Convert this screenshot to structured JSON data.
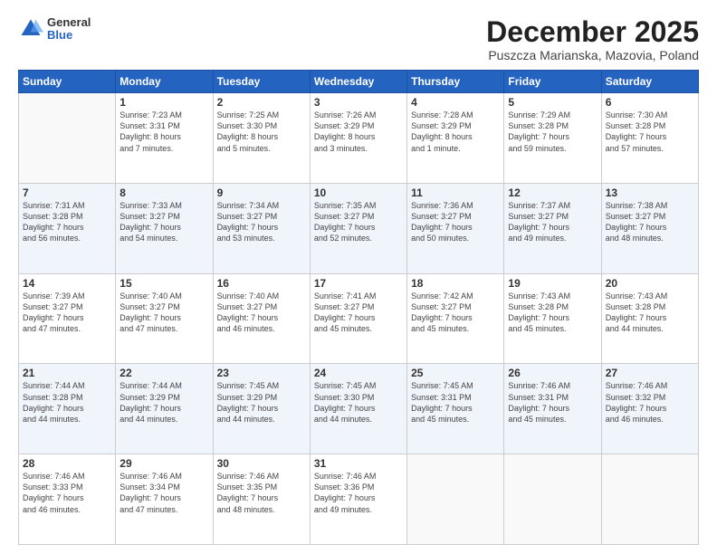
{
  "logo": {
    "general": "General",
    "blue": "Blue"
  },
  "header": {
    "month": "December 2025",
    "location": "Puszcza Marianska, Mazovia, Poland"
  },
  "weekdays": [
    "Sunday",
    "Monday",
    "Tuesday",
    "Wednesday",
    "Thursday",
    "Friday",
    "Saturday"
  ],
  "weeks": [
    [
      {
        "day": "",
        "info": ""
      },
      {
        "day": "1",
        "info": "Sunrise: 7:23 AM\nSunset: 3:31 PM\nDaylight: 8 hours\nand 7 minutes."
      },
      {
        "day": "2",
        "info": "Sunrise: 7:25 AM\nSunset: 3:30 PM\nDaylight: 8 hours\nand 5 minutes."
      },
      {
        "day": "3",
        "info": "Sunrise: 7:26 AM\nSunset: 3:29 PM\nDaylight: 8 hours\nand 3 minutes."
      },
      {
        "day": "4",
        "info": "Sunrise: 7:28 AM\nSunset: 3:29 PM\nDaylight: 8 hours\nand 1 minute."
      },
      {
        "day": "5",
        "info": "Sunrise: 7:29 AM\nSunset: 3:28 PM\nDaylight: 7 hours\nand 59 minutes."
      },
      {
        "day": "6",
        "info": "Sunrise: 7:30 AM\nSunset: 3:28 PM\nDaylight: 7 hours\nand 57 minutes."
      }
    ],
    [
      {
        "day": "7",
        "info": "Sunrise: 7:31 AM\nSunset: 3:28 PM\nDaylight: 7 hours\nand 56 minutes."
      },
      {
        "day": "8",
        "info": "Sunrise: 7:33 AM\nSunset: 3:27 PM\nDaylight: 7 hours\nand 54 minutes."
      },
      {
        "day": "9",
        "info": "Sunrise: 7:34 AM\nSunset: 3:27 PM\nDaylight: 7 hours\nand 53 minutes."
      },
      {
        "day": "10",
        "info": "Sunrise: 7:35 AM\nSunset: 3:27 PM\nDaylight: 7 hours\nand 52 minutes."
      },
      {
        "day": "11",
        "info": "Sunrise: 7:36 AM\nSunset: 3:27 PM\nDaylight: 7 hours\nand 50 minutes."
      },
      {
        "day": "12",
        "info": "Sunrise: 7:37 AM\nSunset: 3:27 PM\nDaylight: 7 hours\nand 49 minutes."
      },
      {
        "day": "13",
        "info": "Sunrise: 7:38 AM\nSunset: 3:27 PM\nDaylight: 7 hours\nand 48 minutes."
      }
    ],
    [
      {
        "day": "14",
        "info": "Sunrise: 7:39 AM\nSunset: 3:27 PM\nDaylight: 7 hours\nand 47 minutes."
      },
      {
        "day": "15",
        "info": "Sunrise: 7:40 AM\nSunset: 3:27 PM\nDaylight: 7 hours\nand 47 minutes."
      },
      {
        "day": "16",
        "info": "Sunrise: 7:40 AM\nSunset: 3:27 PM\nDaylight: 7 hours\nand 46 minutes."
      },
      {
        "day": "17",
        "info": "Sunrise: 7:41 AM\nSunset: 3:27 PM\nDaylight: 7 hours\nand 45 minutes."
      },
      {
        "day": "18",
        "info": "Sunrise: 7:42 AM\nSunset: 3:27 PM\nDaylight: 7 hours\nand 45 minutes."
      },
      {
        "day": "19",
        "info": "Sunrise: 7:43 AM\nSunset: 3:28 PM\nDaylight: 7 hours\nand 45 minutes."
      },
      {
        "day": "20",
        "info": "Sunrise: 7:43 AM\nSunset: 3:28 PM\nDaylight: 7 hours\nand 44 minutes."
      }
    ],
    [
      {
        "day": "21",
        "info": "Sunrise: 7:44 AM\nSunset: 3:28 PM\nDaylight: 7 hours\nand 44 minutes."
      },
      {
        "day": "22",
        "info": "Sunrise: 7:44 AM\nSunset: 3:29 PM\nDaylight: 7 hours\nand 44 minutes."
      },
      {
        "day": "23",
        "info": "Sunrise: 7:45 AM\nSunset: 3:29 PM\nDaylight: 7 hours\nand 44 minutes."
      },
      {
        "day": "24",
        "info": "Sunrise: 7:45 AM\nSunset: 3:30 PM\nDaylight: 7 hours\nand 44 minutes."
      },
      {
        "day": "25",
        "info": "Sunrise: 7:45 AM\nSunset: 3:31 PM\nDaylight: 7 hours\nand 45 minutes."
      },
      {
        "day": "26",
        "info": "Sunrise: 7:46 AM\nSunset: 3:31 PM\nDaylight: 7 hours\nand 45 minutes."
      },
      {
        "day": "27",
        "info": "Sunrise: 7:46 AM\nSunset: 3:32 PM\nDaylight: 7 hours\nand 46 minutes."
      }
    ],
    [
      {
        "day": "28",
        "info": "Sunrise: 7:46 AM\nSunset: 3:33 PM\nDaylight: 7 hours\nand 46 minutes."
      },
      {
        "day": "29",
        "info": "Sunrise: 7:46 AM\nSunset: 3:34 PM\nDaylight: 7 hours\nand 47 minutes."
      },
      {
        "day": "30",
        "info": "Sunrise: 7:46 AM\nSunset: 3:35 PM\nDaylight: 7 hours\nand 48 minutes."
      },
      {
        "day": "31",
        "info": "Sunrise: 7:46 AM\nSunset: 3:36 PM\nDaylight: 7 hours\nand 49 minutes."
      },
      {
        "day": "",
        "info": ""
      },
      {
        "day": "",
        "info": ""
      },
      {
        "day": "",
        "info": ""
      }
    ]
  ]
}
